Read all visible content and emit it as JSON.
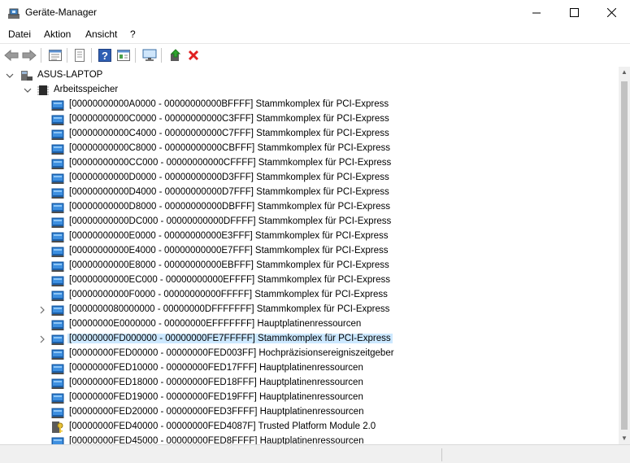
{
  "window": {
    "title": "Geräte-Manager",
    "minimize": "—",
    "maximize": "☐",
    "close": "✕"
  },
  "menu": [
    "Datei",
    "Aktion",
    "Ansicht",
    "?"
  ],
  "toolbar": {
    "icons": [
      "back-icon",
      "forward-icon",
      "properties-icon",
      "view-icon",
      "help-icon",
      "show-hidden-icon",
      "monitor-icon",
      "update-driver-icon",
      "uninstall-icon"
    ]
  },
  "tree": {
    "root": "ASUS-LAPTOP",
    "group": "Arbeitsspeicher",
    "items": [
      {
        "label": "[00000000000A0000 - 00000000000BFFFF]  Stammkomplex für PCI-Express",
        "icon": "pci-icon",
        "expandable": false,
        "selected": false
      },
      {
        "label": "[00000000000C0000 - 00000000000C3FFF]  Stammkomplex für PCI-Express",
        "icon": "pci-icon",
        "expandable": false,
        "selected": false
      },
      {
        "label": "[00000000000C4000 - 00000000000C7FFF]  Stammkomplex für PCI-Express",
        "icon": "pci-icon",
        "expandable": false,
        "selected": false
      },
      {
        "label": "[00000000000C8000 - 00000000000CBFFF]  Stammkomplex für PCI-Express",
        "icon": "pci-icon",
        "expandable": false,
        "selected": false
      },
      {
        "label": "[00000000000CC000 - 00000000000CFFFF]  Stammkomplex für PCI-Express",
        "icon": "pci-icon",
        "expandable": false,
        "selected": false
      },
      {
        "label": "[00000000000D0000 - 00000000000D3FFF]  Stammkomplex für PCI-Express",
        "icon": "pci-icon",
        "expandable": false,
        "selected": false
      },
      {
        "label": "[00000000000D4000 - 00000000000D7FFF]  Stammkomplex für PCI-Express",
        "icon": "pci-icon",
        "expandable": false,
        "selected": false
      },
      {
        "label": "[00000000000D8000 - 00000000000DBFFF]  Stammkomplex für PCI-Express",
        "icon": "pci-icon",
        "expandable": false,
        "selected": false
      },
      {
        "label": "[00000000000DC000 - 00000000000DFFFF]  Stammkomplex für PCI-Express",
        "icon": "pci-icon",
        "expandable": false,
        "selected": false
      },
      {
        "label": "[00000000000E0000 - 00000000000E3FFF]  Stammkomplex für PCI-Express",
        "icon": "pci-icon",
        "expandable": false,
        "selected": false
      },
      {
        "label": "[00000000000E4000 - 00000000000E7FFF]  Stammkomplex für PCI-Express",
        "icon": "pci-icon",
        "expandable": false,
        "selected": false
      },
      {
        "label": "[00000000000E8000 - 00000000000EBFFF]  Stammkomplex für PCI-Express",
        "icon": "pci-icon",
        "expandable": false,
        "selected": false
      },
      {
        "label": "[00000000000EC000 - 00000000000EFFFF]  Stammkomplex für PCI-Express",
        "icon": "pci-icon",
        "expandable": false,
        "selected": false
      },
      {
        "label": "[00000000000F0000 - 00000000000FFFFF]  Stammkomplex für PCI-Express",
        "icon": "pci-icon",
        "expandable": false,
        "selected": false
      },
      {
        "label": "[0000000080000000 - 00000000DFFFFFFF]  Stammkomplex für PCI-Express",
        "icon": "pci-icon",
        "expandable": true,
        "selected": false
      },
      {
        "label": "[00000000E0000000 - 00000000EFFFFFFF]  Hauptplatinenressourcen",
        "icon": "pci-icon",
        "expandable": false,
        "selected": false
      },
      {
        "label": "[00000000FD000000 - 00000000FE7FFFFF]  Stammkomplex für PCI-Express",
        "icon": "pci-icon",
        "expandable": true,
        "selected": true
      },
      {
        "label": "[00000000FED00000 - 00000000FED003FF]  Hochpräzisionsereigniszeitgeber",
        "icon": "pci-icon",
        "expandable": false,
        "selected": false
      },
      {
        "label": "[00000000FED10000 - 00000000FED17FFF]  Hauptplatinenressourcen",
        "icon": "pci-icon",
        "expandable": false,
        "selected": false
      },
      {
        "label": "[00000000FED18000 - 00000000FED18FFF]  Hauptplatinenressourcen",
        "icon": "pci-icon",
        "expandable": false,
        "selected": false
      },
      {
        "label": "[00000000FED19000 - 00000000FED19FFF]  Hauptplatinenressourcen",
        "icon": "pci-icon",
        "expandable": false,
        "selected": false
      },
      {
        "label": "[00000000FED20000 - 00000000FED3FFFF]  Hauptplatinenressourcen",
        "icon": "pci-icon",
        "expandable": false,
        "selected": false
      },
      {
        "label": "[00000000FED40000 - 00000000FED4087F]  Trusted Platform Module 2.0",
        "icon": "tpm-key-icon",
        "expandable": false,
        "selected": false
      },
      {
        "label": "[00000000FED45000 - 00000000FED8FFFF]  Hauptplatinenressourcen",
        "icon": "pci-icon",
        "expandable": false,
        "selected": false
      }
    ]
  }
}
